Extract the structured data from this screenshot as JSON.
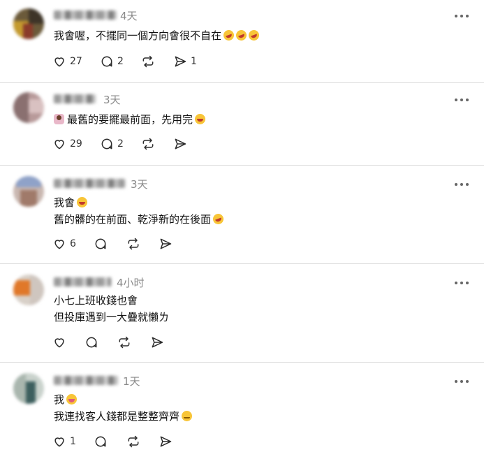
{
  "comments": [
    {
      "time": "4天",
      "lines": [
        "我會喔，不擺同一個方向會很不自在"
      ],
      "likes": "27",
      "replies": "2",
      "reposts": "",
      "shares": "1"
    },
    {
      "time": "3天",
      "lines": [
        "最舊的要擺最前面，先用完"
      ],
      "likes": "29",
      "replies": "2",
      "reposts": "",
      "shares": ""
    },
    {
      "time": "3天",
      "lines": [
        "我會",
        "舊的髒的在前面、乾淨新的在後面"
      ],
      "likes": "6",
      "replies": "",
      "reposts": "",
      "shares": ""
    },
    {
      "time": "4小时",
      "lines": [
        "小七上班收錢也會",
        "但投庫遇到一大疊就懶ㄌ"
      ],
      "likes": "",
      "replies": "",
      "reposts": "",
      "shares": ""
    },
    {
      "time": "1天",
      "lines": [
        "我",
        "我連找客人錢都是整整齊齊"
      ],
      "likes": "1",
      "replies": "",
      "reposts": "",
      "shares": ""
    }
  ],
  "icons": {
    "like": "heart-icon",
    "reply": "speech-bubble-icon",
    "repost": "repost-icon",
    "share": "send-icon",
    "more": "more-dots-icon"
  },
  "colors": {
    "divider": "#dcdcdc",
    "timestamp": "#8a8a8a",
    "emoji": "#f8c538"
  }
}
